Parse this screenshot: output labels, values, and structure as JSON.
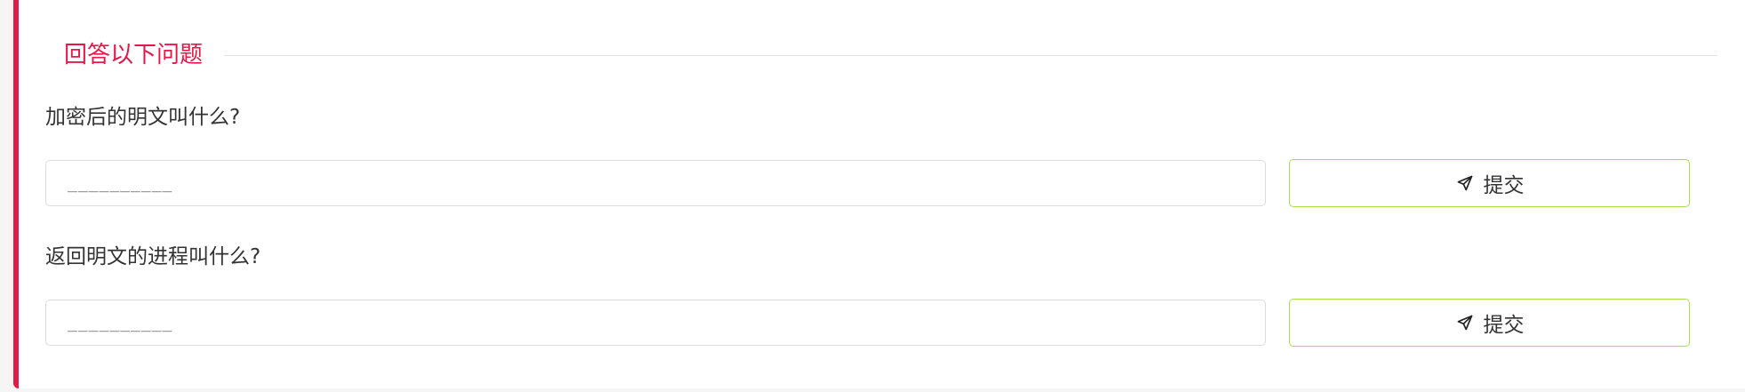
{
  "section": {
    "title": "回答以下问题"
  },
  "questions": [
    {
      "label": "加密后的明文叫什么?",
      "placeholder": "__________",
      "value": "",
      "submit_label": "提交",
      "submit_icon": "send-icon"
    },
    {
      "label": "返回明文的进程叫什么?",
      "placeholder": "__________",
      "value": "",
      "submit_label": "提交",
      "submit_icon": "send-icon"
    }
  ],
  "colors": {
    "accent": "#e8174a",
    "button_border": "#a8e04a",
    "input_border": "#dcdcdc"
  }
}
